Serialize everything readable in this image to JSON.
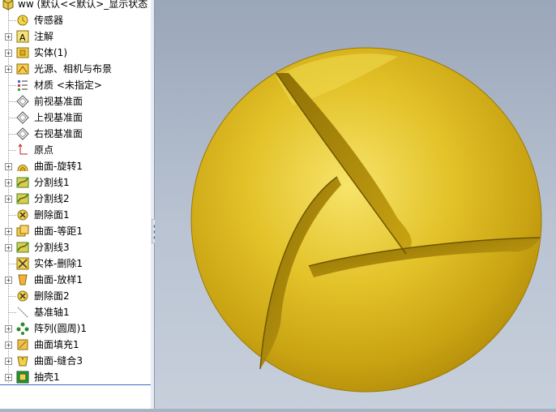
{
  "tree": {
    "root": "ww  (默认<<默认>_显示状态",
    "items": [
      {
        "label": "传感器",
        "expand": false,
        "icon": "sensor-icon"
      },
      {
        "label": "注解",
        "expand": true,
        "icon": "annotation-icon"
      },
      {
        "label": "实体(1)",
        "expand": true,
        "icon": "solid-bodies-icon"
      },
      {
        "label": "光源、相机与布景",
        "expand": true,
        "icon": "lights-cameras-icon"
      },
      {
        "label": "材质 <未指定>",
        "expand": false,
        "icon": "material-icon"
      },
      {
        "label": "前视基准面",
        "expand": false,
        "icon": "plane-icon"
      },
      {
        "label": "上视基准面",
        "expand": false,
        "icon": "plane-icon"
      },
      {
        "label": "右视基准面",
        "expand": false,
        "icon": "plane-icon"
      },
      {
        "label": "原点",
        "expand": false,
        "icon": "origin-icon"
      },
      {
        "label": "曲面-旋转1",
        "expand": true,
        "icon": "surface-revolve-icon"
      },
      {
        "label": "分割线1",
        "expand": true,
        "icon": "split-line-icon"
      },
      {
        "label": "分割线2",
        "expand": true,
        "icon": "split-line-icon"
      },
      {
        "label": "删除面1",
        "expand": false,
        "icon": "delete-face-icon"
      },
      {
        "label": "曲面-等距1",
        "expand": true,
        "icon": "surface-offset-icon"
      },
      {
        "label": "分割线3",
        "expand": true,
        "icon": "split-line-icon"
      },
      {
        "label": "实体-删除1",
        "expand": false,
        "icon": "body-delete-icon"
      },
      {
        "label": "曲面-放样1",
        "expand": true,
        "icon": "surface-loft-icon"
      },
      {
        "label": "删除面2",
        "expand": false,
        "icon": "delete-face-icon"
      },
      {
        "label": "基准轴1",
        "expand": false,
        "icon": "axis-icon"
      },
      {
        "label": "阵列(圆周)1",
        "expand": true,
        "icon": "circular-pattern-icon"
      },
      {
        "label": "曲面填充1",
        "expand": true,
        "icon": "surface-fill-icon"
      },
      {
        "label": "曲面-缝合3",
        "expand": true,
        "icon": "surface-knit-icon"
      },
      {
        "label": "抽壳1",
        "expand": true,
        "icon": "shell-icon"
      }
    ]
  },
  "colors": {
    "selection": "#3b6ac8",
    "model": "#e6c320"
  }
}
